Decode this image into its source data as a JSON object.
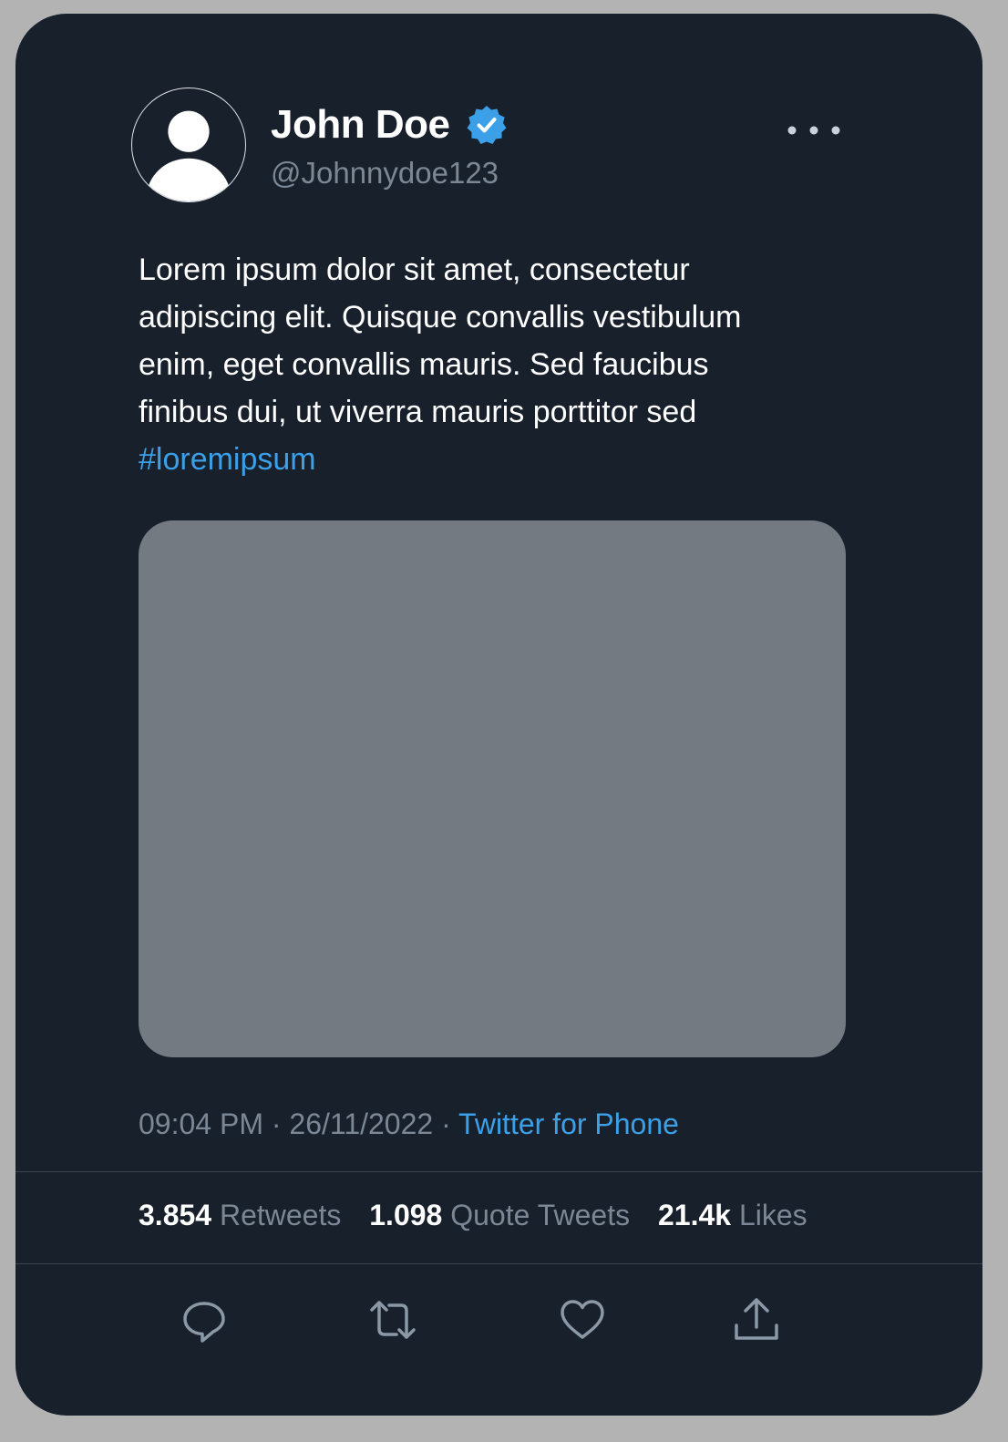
{
  "user": {
    "name": "John Doe",
    "handle": "@Johnnydoe123",
    "verified": true
  },
  "tweet": {
    "lines": [
      "Lorem ipsum dolor sit amet, consectetur",
      "adipiscing elit. Quisque convallis vestibulum",
      "enim, eget convallis mauris. Sed faucibus",
      "finibus dui, ut viverra mauris porttitor sed"
    ],
    "hashtag": "#loremipsum"
  },
  "meta": {
    "time": "09:04 PM",
    "separator": "·",
    "date": "26/11/2022",
    "source": "Twitter for Phone"
  },
  "stats": {
    "retweets_count": "3.854",
    "retweets_label": "Retweets",
    "quotes_count": "1.098",
    "quotes_label": "Quote Tweets",
    "likes_count": "21.4k",
    "likes_label": "Likes"
  },
  "icons": {
    "reply": "comment-icon",
    "retweet": "retweet-icon",
    "like": "heart-icon",
    "share": "share-icon",
    "more": "more-icon",
    "verified": "verified-badge-icon"
  },
  "colors": {
    "background": "#18202c",
    "accent": "#3ba0e8",
    "muted": "#7b8794",
    "media_placeholder": "#737a82"
  }
}
